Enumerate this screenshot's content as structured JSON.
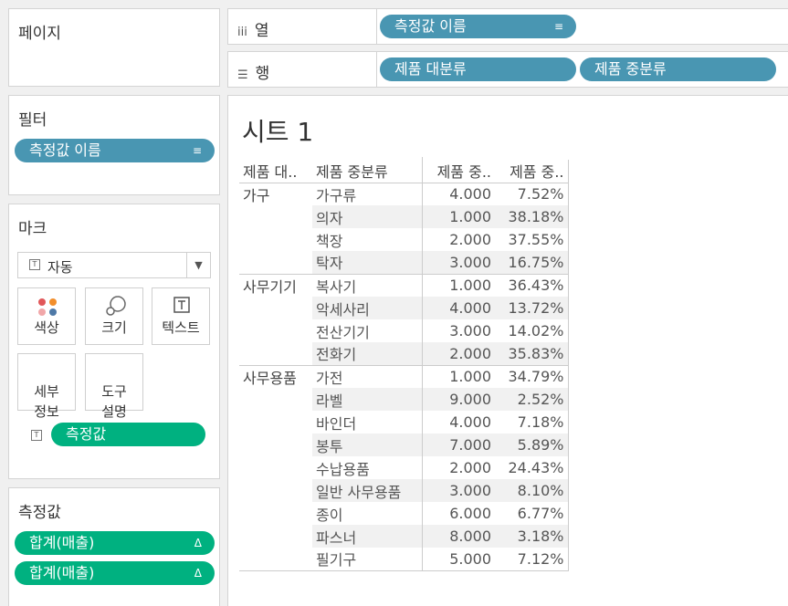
{
  "pages": {
    "title": "페이지"
  },
  "filters": {
    "title": "필터",
    "pill": "측정값 이름"
  },
  "marks": {
    "title": "마크",
    "dropdown": "자동",
    "buttons": {
      "color": "색상",
      "size": "크기",
      "text": "텍스트",
      "detail": "세부\n정보",
      "tooltip": "도구\n설명"
    },
    "text_pill": "측정값"
  },
  "measure_values": {
    "title": "측정값",
    "pills": [
      "합계(매출)",
      "합계(매출)"
    ]
  },
  "columns": {
    "label": "열",
    "pill": "측정값 이름"
  },
  "rows": {
    "label": "행",
    "pills": [
      "제품 대분류",
      "제품 중분류"
    ]
  },
  "sheet": {
    "title": "시트 1",
    "headers": [
      "제품 대..",
      "제품 중분류",
      "제품 중..",
      "제품 중.."
    ],
    "groups": [
      {
        "name": "가구",
        "rows": [
          [
            "가구류",
            "4.000",
            "7.52%"
          ],
          [
            "의자",
            "1.000",
            "38.18%"
          ],
          [
            "책장",
            "2.000",
            "37.55%"
          ],
          [
            "탁자",
            "3.000",
            "16.75%"
          ]
        ]
      },
      {
        "name": "사무기기",
        "rows": [
          [
            "복사기",
            "1.000",
            "36.43%"
          ],
          [
            "악세사리",
            "4.000",
            "13.72%"
          ],
          [
            "전산기기",
            "3.000",
            "14.02%"
          ],
          [
            "전화기",
            "2.000",
            "35.83%"
          ]
        ]
      },
      {
        "name": "사무용품",
        "rows": [
          [
            "가전",
            "1.000",
            "34.79%"
          ],
          [
            "라벨",
            "9.000",
            "2.52%"
          ],
          [
            "바인더",
            "4.000",
            "7.18%"
          ],
          [
            "봉투",
            "7.000",
            "5.89%"
          ],
          [
            "수납용품",
            "2.000",
            "24.43%"
          ],
          [
            "일반 사무용품",
            "3.000",
            "8.10%"
          ],
          [
            "종이",
            "6.000",
            "6.77%"
          ],
          [
            "파스너",
            "8.000",
            "3.18%"
          ],
          [
            "필기구",
            "5.000",
            "7.12%"
          ]
        ]
      }
    ]
  }
}
